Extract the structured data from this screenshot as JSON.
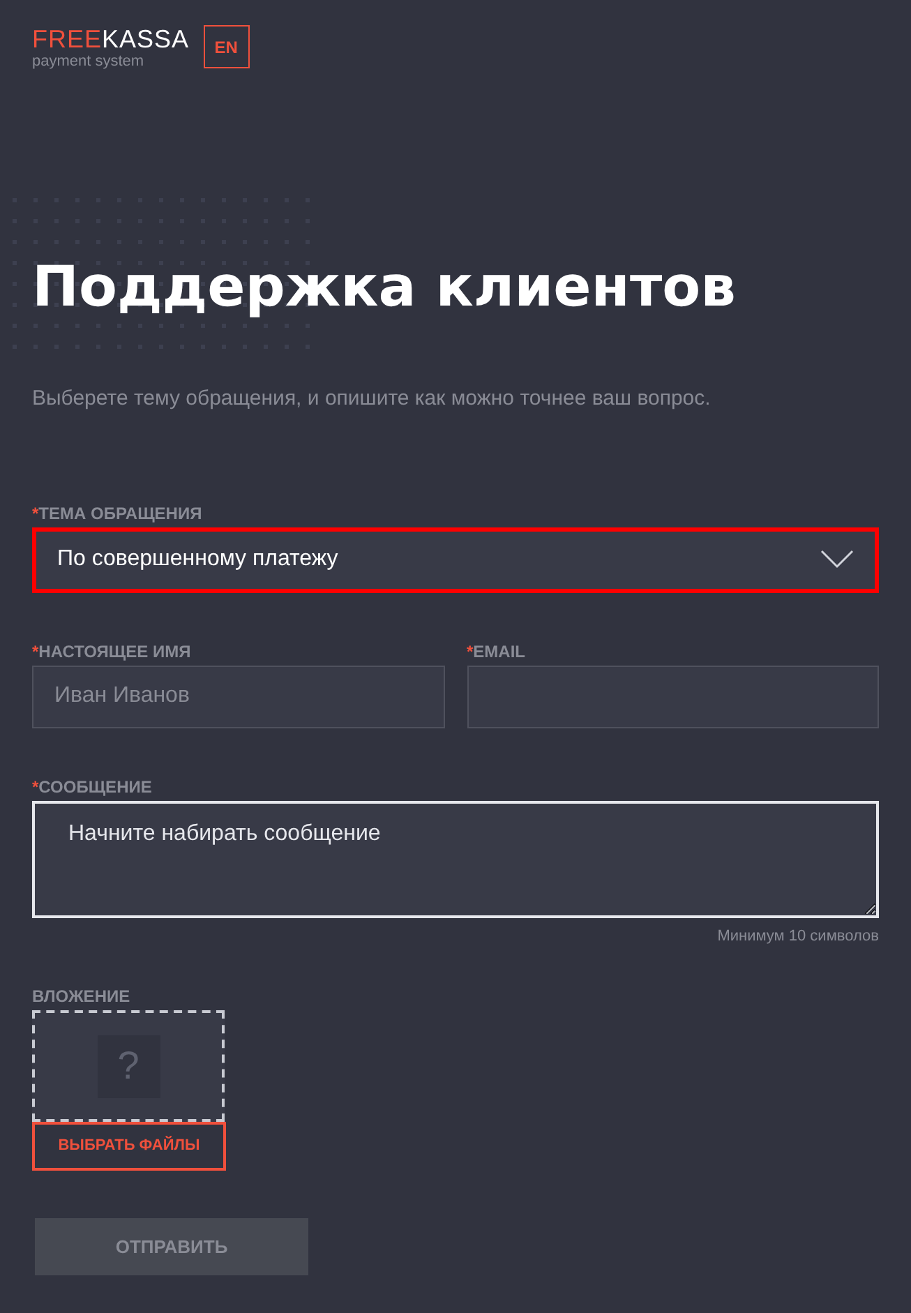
{
  "logo": {
    "accent": "FREE",
    "rest": "KASSA",
    "tagline": "payment system"
  },
  "language_button": "EN",
  "title": "Поддержка клиентов",
  "subtitle": "Выберете тему обращения, и опишите как можно точнее ваш вопрос.",
  "subject": {
    "mark": "*",
    "label": "ТЕМА ОБРАЩЕНИЯ",
    "value": "По совершенному платежу",
    "invalid": true
  },
  "name": {
    "mark": "*",
    "label": "НАСТОЯЩЕЕ ИМЯ",
    "placeholder": "Иван Иванов"
  },
  "email": {
    "mark": "*",
    "label": "EMAIL"
  },
  "message": {
    "mark": "*",
    "label": "СООБЩЕНИЕ",
    "placeholder": "Начните набирать сообщение",
    "focused": true,
    "hint": "Минимум 10 символов"
  },
  "attachment": {
    "label": "ВЛОЖЕНИЕ",
    "preview_glyph": "?",
    "button": "ВЫБРАТЬ ФАЙЛЫ"
  },
  "submit": {
    "label": "ОТПРАВИТЬ",
    "disabled": true
  }
}
